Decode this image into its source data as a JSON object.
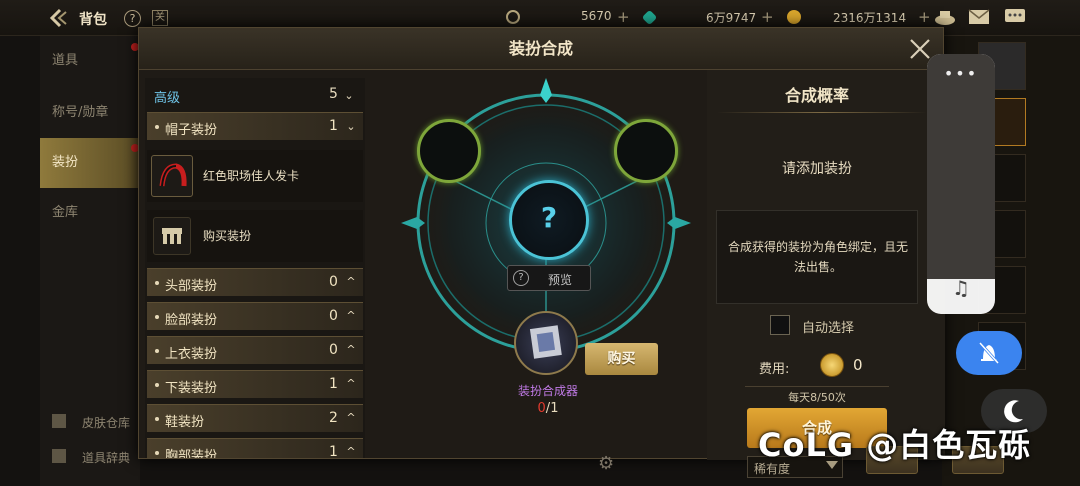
{
  "topbar": {
    "title": "背包",
    "help_label": "?",
    "currency1": "5670",
    "currency2": "6万9747",
    "currency3": "2316万1314",
    "plus": "+",
    "colors": {
      "gold": "#d9a52c",
      "gem": "#1fa58f"
    }
  },
  "leftnav": {
    "items": [
      {
        "label": "道具"
      },
      {
        "label": "称号/勋章"
      },
      {
        "label": "装扮"
      },
      {
        "label": "金库"
      }
    ],
    "bottom": [
      {
        "label": "皮肤仓库"
      },
      {
        "label": "道具辞典"
      }
    ]
  },
  "modal": {
    "title": "装扮合成",
    "close_icon": "close-icon",
    "category": {
      "header_label": "高级",
      "header_count": "5",
      "rows": [
        {
          "label": "帽子装扮",
          "count": "1",
          "expanded": true
        },
        {
          "label": "头部装扮",
          "count": "0"
        },
        {
          "label": "脸部装扮",
          "count": "0"
        },
        {
          "label": "上衣装扮",
          "count": "0"
        },
        {
          "label": "下装装扮",
          "count": "1"
        },
        {
          "label": "鞋装扮",
          "count": "2"
        },
        {
          "label": "胸部装扮",
          "count": "1"
        }
      ],
      "items": [
        {
          "label": "红色职场佳人发卡"
        },
        {
          "label": "购买装扮"
        }
      ]
    },
    "synth": {
      "center_symbol": "?",
      "preview_label": "预览",
      "material_label": "装扮合成器",
      "material_current": "0",
      "material_sep": "/",
      "material_total": "1",
      "buy_label": "购买"
    },
    "right": {
      "title": "合成概率",
      "prompt": "请添加装扮",
      "note": "合成获得的装扮为角色绑定，且无法出售。",
      "auto_select_label": "自动选择",
      "auto_select_checked": false,
      "fee_label": "费用:",
      "fee_value": "0",
      "daily_limit": "每天8/50次",
      "synth_button": "合成"
    },
    "footer": {
      "sort_label": "稀有度"
    }
  },
  "overlay": {
    "dots": "•••",
    "watermark": "CoLG @白色瓦砾"
  }
}
